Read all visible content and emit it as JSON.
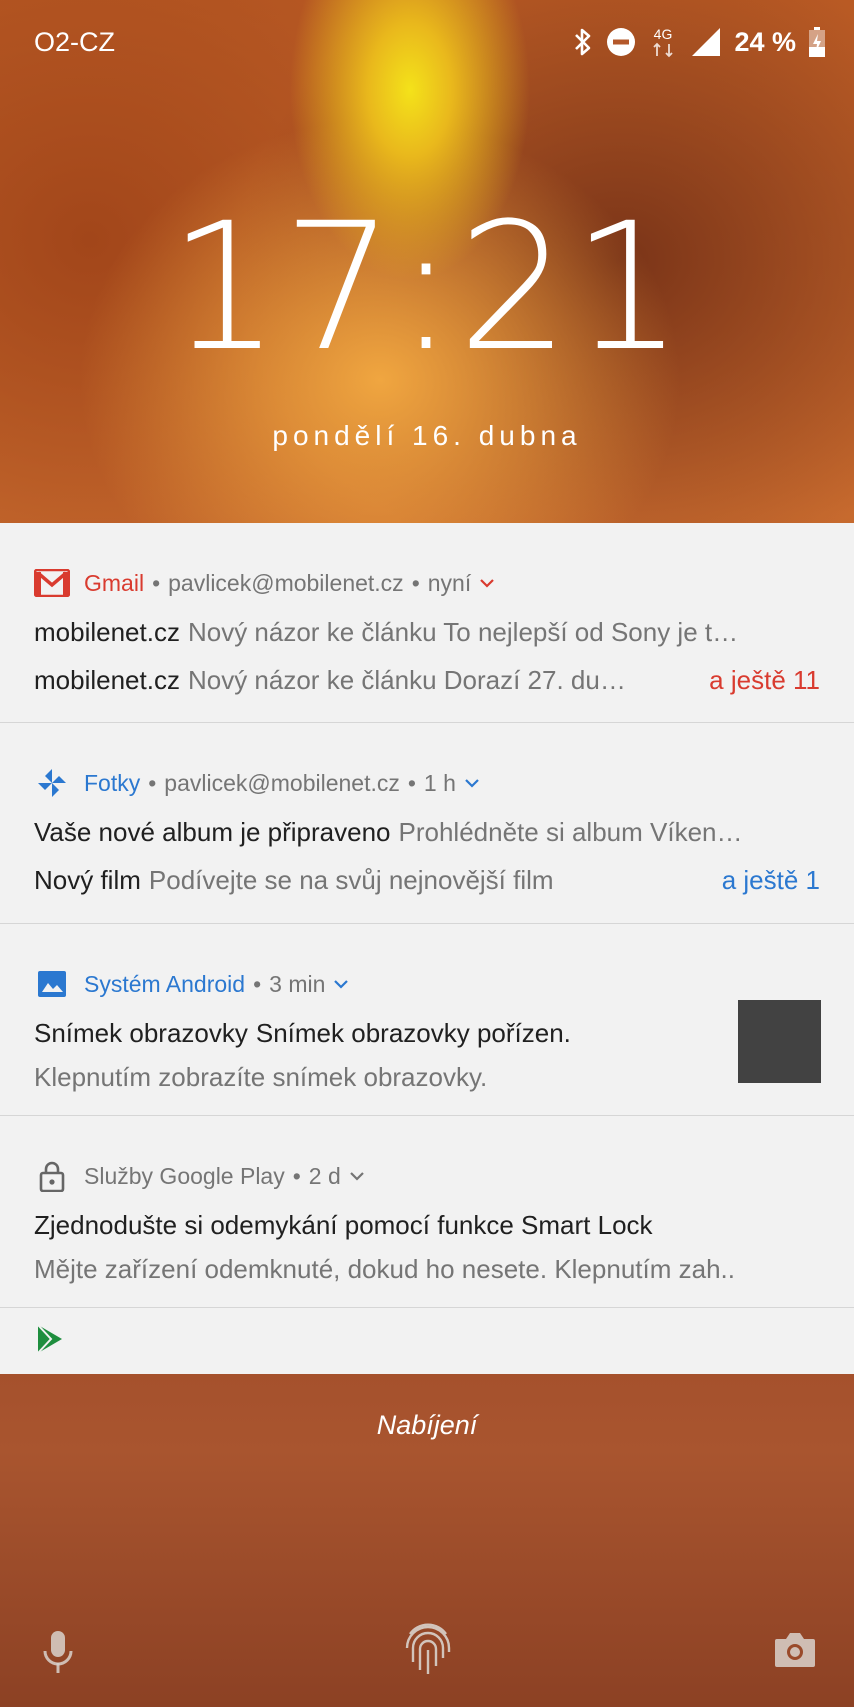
{
  "status_bar": {
    "carrier": "O2-CZ",
    "network": "4G",
    "battery": "24 %",
    "icons": [
      "bluetooth-icon",
      "do-not-disturb-icon",
      "network-4g-icon",
      "signal-icon",
      "battery-charging-icon"
    ]
  },
  "lock": {
    "time": "17:21",
    "date": "pondělí 16. dubna",
    "charging": "Nabíjení"
  },
  "notifications": {
    "gmail": {
      "app": "Gmail",
      "account": "pavlicek@mobilenet.cz",
      "time": "nyní",
      "lines": [
        {
          "primary": "mobilenet.cz",
          "secondary": "Nový názor ke článku To nejlepší od Sony je t…"
        },
        {
          "primary": "mobilenet.cz",
          "secondary": "Nový názor ke článku Dorazí 27. du…",
          "more": "a ještě 11"
        }
      ],
      "accent": "#d93b2f"
    },
    "photos": {
      "app": "Fotky",
      "account": "pavlicek@mobilenet.cz",
      "time": "1 h",
      "lines": [
        {
          "primary": "Vaše nové album je připraveno",
          "secondary": "Prohlédněte si album Víken…"
        },
        {
          "primary": "Nový film",
          "secondary": "Podívejte se na svůj nejnovější film",
          "more": "a ještě 1"
        }
      ],
      "accent": "#2b78d0"
    },
    "android": {
      "app": "Systém Android",
      "time": "3 min",
      "title_primary": "Snímek obrazovky",
      "title_secondary": "Snímek obrazovky pořízen.",
      "text": "Klepnutím zobrazíte snímek obrazovky."
    },
    "play": {
      "app": "Služby Google Play",
      "time": "2 d",
      "title": "Zjednodušte si odemykání pomocí funkce Smart Lock",
      "text": "Mějte zařízení odemknuté, dokud ho nesete. Klepnutím zah.."
    }
  },
  "bottom": {
    "icons": [
      "microphone-icon",
      "fingerprint-icon",
      "camera-icon"
    ]
  }
}
